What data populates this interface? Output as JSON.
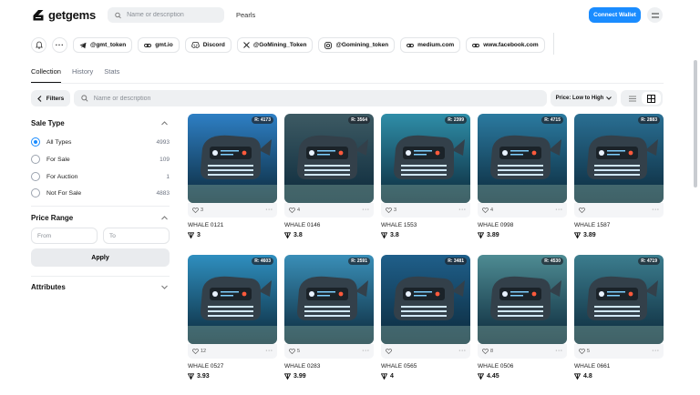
{
  "header": {
    "logo_text": "getgems",
    "search_placeholder": "Name or description",
    "collection_name": "Pearls",
    "connect_label": "Connect Wallet"
  },
  "social": {
    "links": [
      "@gmt_token",
      "gmt.io",
      "Discord",
      "@GoMining_Token",
      "@Gomining_token",
      "medium.com",
      "www.facebook.com"
    ]
  },
  "tabs": [
    "Collection",
    "History",
    "Stats"
  ],
  "filterbar": {
    "filters_label": "Filters",
    "search_placeholder": "Name or description",
    "sort_label": "Price: Low to High"
  },
  "sidebar": {
    "sale_type_title": "Sale Type",
    "options": [
      {
        "label": "All Types",
        "count": "4993",
        "checked": true
      },
      {
        "label": "For Sale",
        "count": "109",
        "checked": false
      },
      {
        "label": "For Auction",
        "count": "1",
        "checked": false
      },
      {
        "label": "Not For Sale",
        "count": "4883",
        "checked": false
      }
    ],
    "price_range_title": "Price Range",
    "from_placeholder": "From",
    "to_placeholder": "To",
    "apply_label": "Apply",
    "attributes_title": "Attributes"
  },
  "items": [
    {
      "rank": "R: 4173",
      "likes": "3",
      "name": "WHALE 0121",
      "price": "3",
      "tone": "#2e7fc4"
    },
    {
      "rank": "R: 3564",
      "likes": "4",
      "name": "WHALE 0146",
      "price": "3.8",
      "tone": "#3d5a63"
    },
    {
      "rank": "R: 2399",
      "likes": "3",
      "name": "WHALE 1553",
      "price": "3.8",
      "tone": "#2f8ea8"
    },
    {
      "rank": "R: 4715",
      "likes": "4",
      "name": "WHALE 0998",
      "price": "3.89",
      "tone": "#2b7aa0"
    },
    {
      "rank": "R: 2883",
      "likes": "",
      "name": "WHALE 1587",
      "price": "3.89",
      "tone": "#2a6f93"
    },
    {
      "rank": "R: 4603",
      "likes": "12",
      "name": "WHALE 0527",
      "price": "3.93",
      "tone": "#2f8fbf"
    },
    {
      "rank": "R: 2591",
      "likes": "5",
      "name": "WHALE 0283",
      "price": "3.99",
      "tone": "#3a8fb8"
    },
    {
      "rank": "R: 3481",
      "likes": "",
      "name": "WHALE 0565",
      "price": "4",
      "tone": "#1f5f8a"
    },
    {
      "rank": "R: 4530",
      "likes": "8",
      "name": "WHALE 0506",
      "price": "4.45",
      "tone": "#4e8c93"
    },
    {
      "rank": "R: 4719",
      "likes": "5",
      "name": "WHALE 0661",
      "price": "4.8",
      "tone": "#3c7d8e"
    }
  ]
}
